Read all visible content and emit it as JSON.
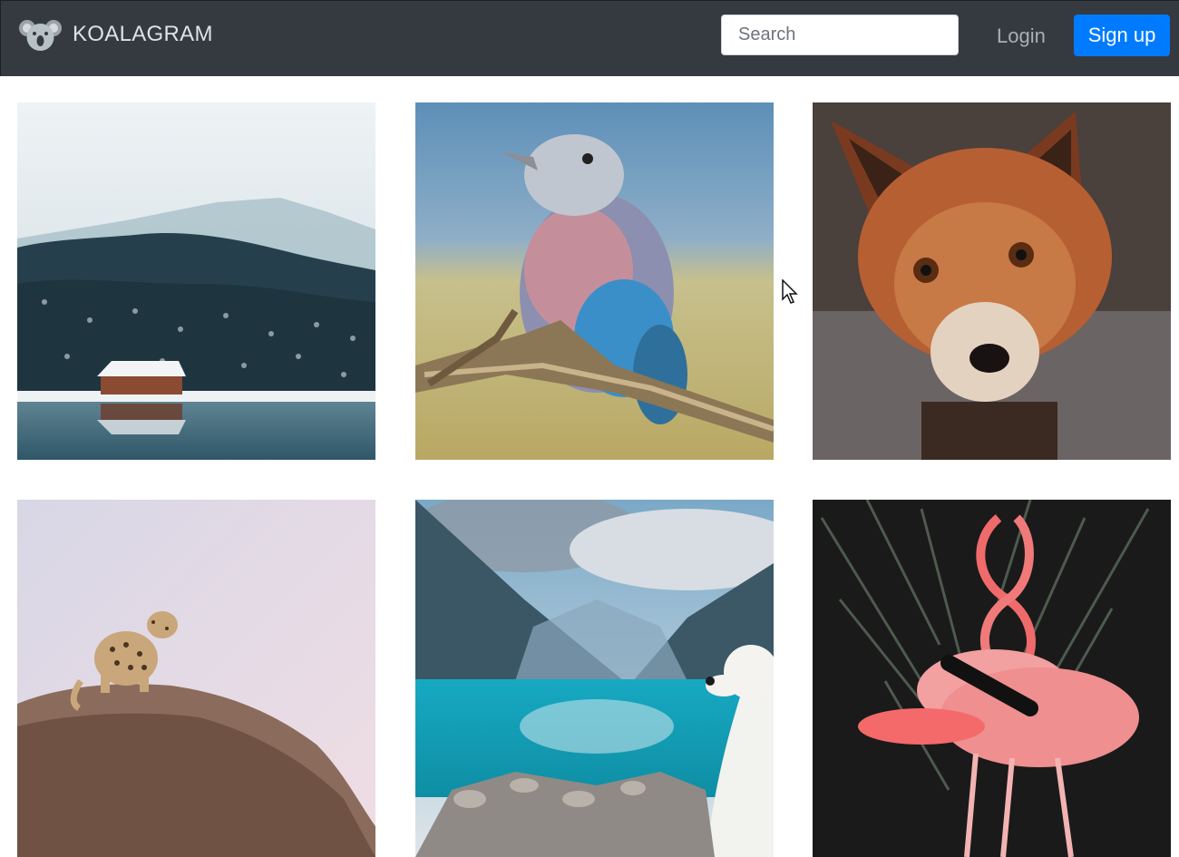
{
  "navbar": {
    "brand": {
      "name": "KOALAGRAM",
      "logo_icon": "koala-icon"
    },
    "search": {
      "placeholder": "Search",
      "value": ""
    },
    "login_label": "Login",
    "signup_label": "Sign up"
  },
  "theme": {
    "navbar_bg": "#343a40",
    "brand_color": "#dee2e6",
    "link_color": "#a9afb4",
    "accent": "#007bff",
    "page_bg": "#ffffff"
  },
  "gallery": {
    "photos": [
      {
        "subject": "snowy-lake-cabin"
      },
      {
        "subject": "lilac-breasted-roller-bird"
      },
      {
        "subject": "red-fox"
      },
      {
        "subject": "leopard-on-rock"
      },
      {
        "subject": "mountain-lake-with-dog"
      },
      {
        "subject": "pink-flamingos"
      }
    ]
  },
  "cursor": {
    "icon": "arrow-cursor-icon"
  }
}
